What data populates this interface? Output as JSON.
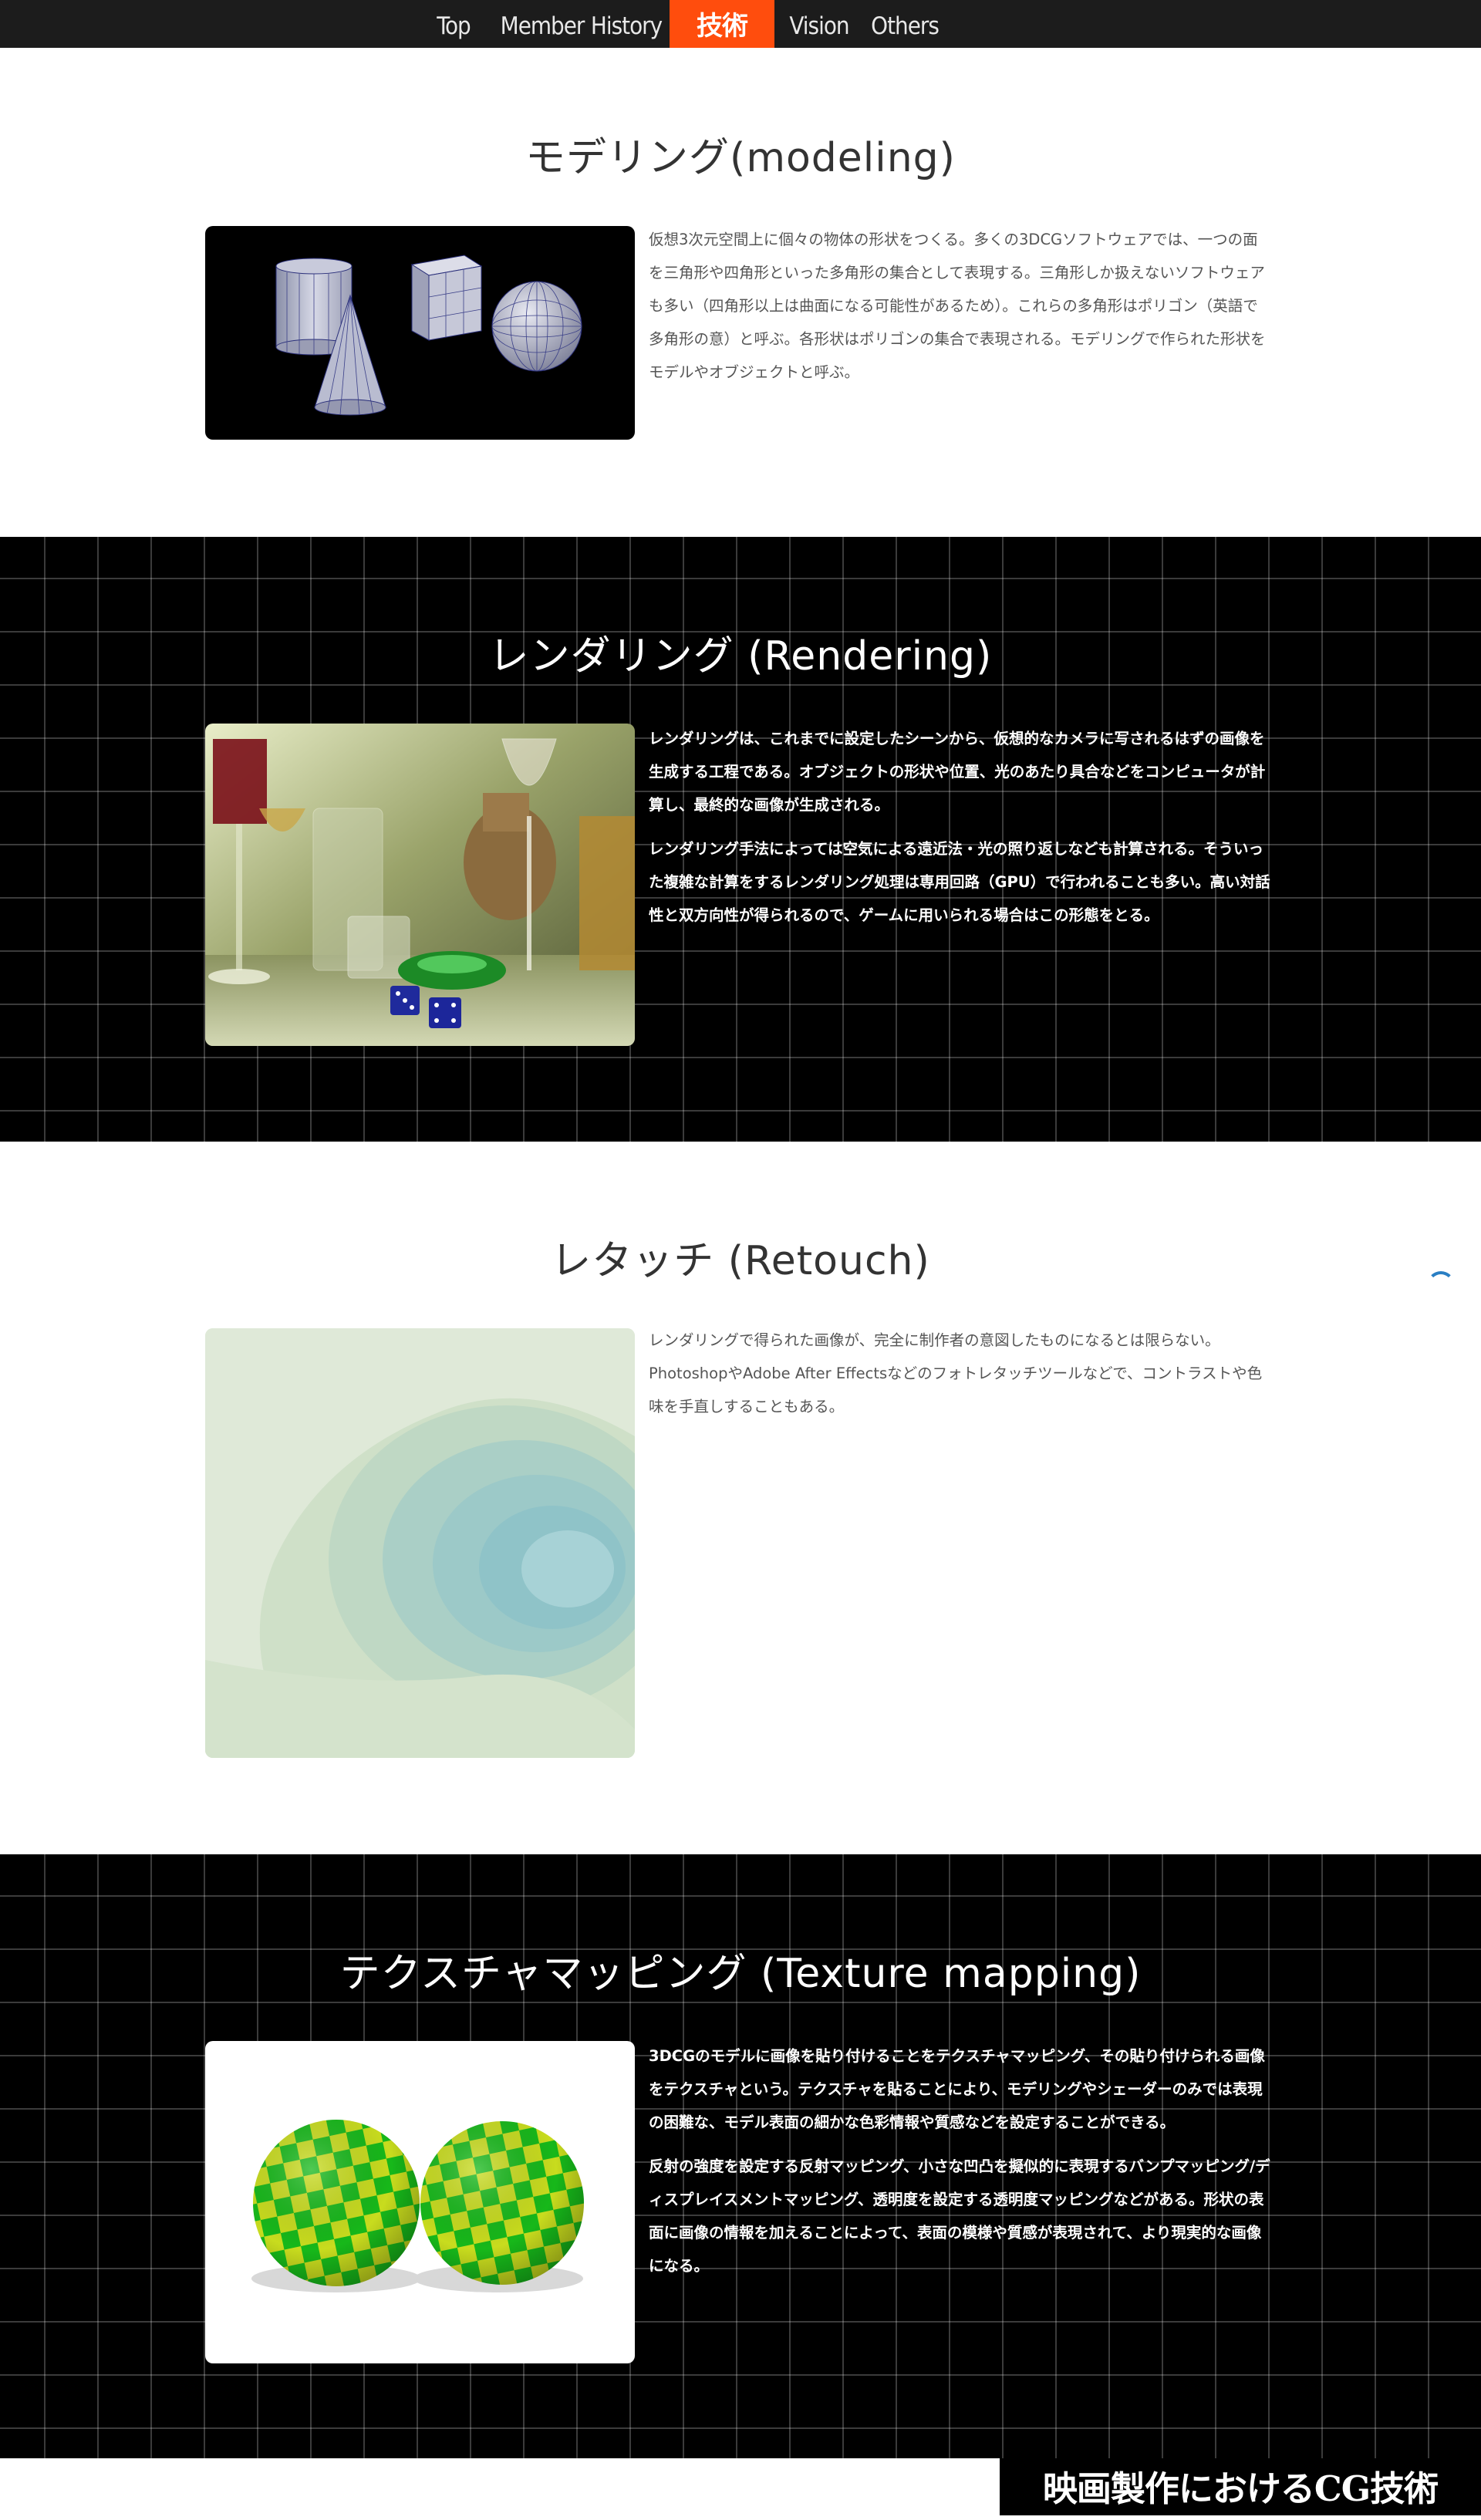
{
  "nav": {
    "items": [
      {
        "label": "Top"
      },
      {
        "label": "Member"
      },
      {
        "label": "History"
      },
      {
        "label": "技術"
      },
      {
        "label": "Vision"
      },
      {
        "label": "Others"
      }
    ],
    "active_color": "#ff4d0d"
  },
  "sections": [
    {
      "title": "モデリング(modeling)",
      "image": "3d-primitives-wireframe",
      "paragraphs": [
        "仮想3次元空間上に個々の物体の形状をつくる。多くの3DCGソフトウェアでは、一つの面を三角形や四角形といった多角形の集合として表現する。三角形しか扱えないソフトウェアも多い（四角形以上は曲面になる可能性があるため）。これらの多角形はポリゴン（英語で多角形の意）と呼ぶ。各形状はポリゴンの集合で表現される。モデリングで作られた形状をモデルやオブジェクトと呼ぶ。"
      ]
    },
    {
      "title": "レンダリング (Rendering)",
      "image": "rendered-glassware-scene",
      "paragraphs": [
        "レンダリングは、これまでに設定したシーンから、仮想的なカメラに写されるはずの画像を生成する工程である。オブジェクトの形状や位置、光のあたり具合などをコンピュータが計算し、最終的な画像が生成される。",
        "レンダリング手法によっては空気による遠近法・光の照り返しなども計算される。そういった複雑な計算をするレンダリング処理は専用回路（GPU）で行われることも多い。高い対話性と双方向性が得られるので、ゲームに用いられる場合はこの形態をとる。"
      ]
    },
    {
      "title": "レタッチ (Retouch)",
      "image": "retouched-abstract-layers",
      "paragraphs": [
        "レンダリングで得られた画像が、完全に制作者の意図したものになるとは限らない。PhotoshopやAdobe After Effectsなどのフォトレタッチツールなどで、コントラストや色味を手直しすることもある。"
      ]
    },
    {
      "title": "テクスチャマッピング (Texture mapping)",
      "image": "checkered-spheres",
      "paragraphs": [
        "3DCGのモデルに画像を貼り付けることをテクスチャマッピング、その貼り付けられる画像をテクスチャという。テクスチャを貼ることにより、モデリングやシェーダーのみでは表現の困難な、モデル表面の細かな色彩情報や質感などを設定することができる。",
        "反射の強度を設定する反射マッピング、小さな凹凸を擬似的に表現するバンプマッピング/ディスプレイスメントマッピング、透明度を設定する透明度マッピングなどがある。形状の表面に画像の情報を加えることによって、表面の模様や質感が表現されて、より現実的な画像になる。"
      ]
    }
  ],
  "footer": {
    "banner": "映画製作におけるCG技術"
  }
}
